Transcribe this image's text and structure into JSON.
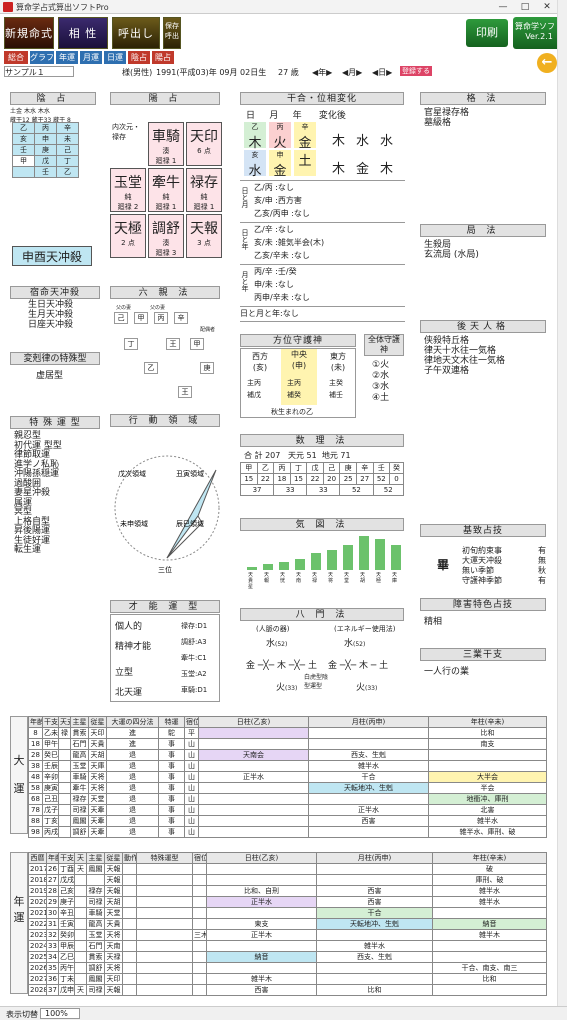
{
  "window": {
    "title": "算命学占式算出ソフトPro",
    "min": "—",
    "max": "□",
    "close": "✕"
  },
  "topbuttons": [
    {
      "top": "新規命式",
      "sub": ""
    },
    {
      "top": "相 性",
      "sub": ""
    },
    {
      "top": "呼出し",
      "sub": ""
    },
    {
      "top": "保存",
      "sub": "呼出"
    }
  ],
  "print_label": "印刷",
  "version": {
    "l1": "算命学ソフト",
    "l2": "Ver.2.1"
  },
  "nav": [
    "総合",
    "グラフ",
    "年運",
    "月運",
    "日運",
    "陰占",
    "陽占"
  ],
  "info": {
    "name": "サンプル１",
    "gender": "様(男性)",
    "date": "1991(平成03)年 09月 02日生",
    "age": "27 歳",
    "y": "◀年▶",
    "m": "◀月▶",
    "d": "◀日▶",
    "reg": "登録する"
  },
  "inzen": {
    "title": "陰 占",
    "hdr": [
      [
        "土金",
        "蔵干12"
      ],
      [
        "木水",
        "蔵干33"
      ],
      [
        "木水",
        "蔵干 8"
      ]
    ],
    "rows": [
      [
        "乙",
        "丙",
        "辛"
      ],
      [
        "亥",
        "申",
        "未"
      ],
      [
        "壬",
        "庚",
        "己"
      ],
      [
        "甲",
        "戊",
        "丁"
      ],
      [
        "",
        "壬",
        "乙"
      ]
    ],
    "tenchu": "申酉天冲殺"
  },
  "yozen": {
    "title": "陽 占",
    "side": "内次元・禄存",
    "cells": [
      {
        "k": "",
        "s1": "",
        "s2": ""
      },
      {
        "k": "車騎",
        "s1": "湊",
        "s2": "廻禄 1"
      },
      {
        "k": "天印",
        "s1": "",
        "s2": "6 点"
      },
      {
        "k": "玉堂",
        "s1": "純",
        "s2": "廻禄 2"
      },
      {
        "k": "牽牛",
        "s1": "純",
        "s2": "廻禄 1"
      },
      {
        "k": "禄存",
        "s1": "純",
        "s2": "廻禄 1"
      },
      {
        "k": "天極",
        "s1": "",
        "s2": "2 点"
      },
      {
        "k": "調舒",
        "s1": "湊",
        "s2": "廻禄 3"
      },
      {
        "k": "天報",
        "s1": "",
        "s2": "3 点"
      }
    ]
  },
  "kango": {
    "title": "干合・位相変化",
    "hdr": [
      "日",
      "月",
      "年",
      "変化後"
    ],
    "top": [
      "乙",
      "丙",
      "辛"
    ],
    "topk": [
      "木",
      "火",
      "金"
    ],
    "mid": [
      "亥",
      "申"
    ],
    "midk": [
      "水",
      "金"
    ],
    "after1": [
      "木",
      "水",
      "水"
    ],
    "after2": [
      "木",
      "金",
      "木"
    ],
    "relations": [
      {
        "g": "日と月",
        "l": [
          "乙/丙 :なし",
          "亥/申 :西方害",
          "乙亥/丙申 :なし"
        ]
      },
      {
        "g": "日と年",
        "l": [
          "乙/辛 :なし",
          "亥/未 :雑気半会(木)",
          "乙亥/辛未 :なし"
        ]
      },
      {
        "g": "月と年",
        "l": [
          "丙/辛 :壬/癸",
          "申/未 :なし",
          "丙申/辛未 :なし"
        ]
      }
    ],
    "footer": "日と月と年:なし"
  },
  "kakuho": {
    "title": "格 法",
    "items": [
      "官星禄存格",
      "墓級格"
    ]
  },
  "kyokuho": {
    "title": "局 法",
    "items": [
      "生殺局",
      "玄流局 (水局)"
    ]
  },
  "gotenjin": {
    "title": "後天人格",
    "items": [
      "侠殺特丘格",
      "律天十水往一気格",
      "律地天文木往一気格",
      "子午双連格"
    ]
  },
  "kisou": {
    "title": "基致占技",
    "main": "畢",
    "items": [
      [
        "初旬約束事",
        "有"
      ],
      [
        "大運天冲殺",
        "無"
      ],
      [
        "無い季節",
        "秋"
      ],
      [
        "守護神季節",
        "有"
      ]
    ]
  },
  "shogai": {
    "title": "障害特色占技",
    "items": [
      "精相"
    ]
  },
  "sanpo": {
    "title": "三業干支",
    "items": [
      "一人行の業"
    ]
  },
  "shukumei": {
    "title": "宿命天冲殺",
    "items": [
      "生日天冲殺",
      "生月天冲殺",
      "日座天冲殺"
    ]
  },
  "hensoku": {
    "title": "変剋律の特殊型",
    "items": [
      "虚居型"
    ]
  },
  "tokushu": {
    "title": "特 殊 運 型",
    "items": [
      "親忍型",
      "初代運 型型",
      "律節取運",
      "進学ノ私恥",
      "沖陽孫穏運",
      "過酸囲",
      "妻星沖殺",
      "属運",
      "冥型",
      "上格自型",
      "昇後陽運",
      "生徒好運",
      "転生運"
    ]
  },
  "rikushin": {
    "title": "六 親 法",
    "labels": [
      "父の妻",
      "父の妻",
      "配偶者",
      "己",
      "甲",
      "丙",
      "辛",
      "丁",
      "王",
      "甲",
      "乙",
      "己",
      "庚",
      "王",
      "配偶者",
      "配偶者",
      "兄弟",
      "弟",
      "子供",
      "男の子供の子"
    ]
  },
  "koudou": {
    "title": "行 動 領 域",
    "labels": [
      "戊次領域",
      "丑寅領域",
      "未申領域",
      "辰巳領域",
      "三位",
      "昇型"
    ]
  },
  "houi": {
    "title": "方位守護神",
    "cols": [
      {
        "h": "西方",
        "s": "(亥)",
        "a": "主丙",
        "b": "補戊"
      },
      {
        "h": "中央",
        "s": "(申)",
        "a": "主丙",
        "b": "補癸"
      },
      {
        "h": "東方",
        "s": "(未)",
        "a": "主癸",
        "b": "補壬"
      }
    ],
    "foot": "秋生まれの乙"
  },
  "zentai": {
    "title": "全体守護神",
    "items": [
      "①火",
      "②水",
      "③水",
      "④土"
    ]
  },
  "suri": {
    "title": "数 理 法",
    "total": "合 計 207",
    "ten": "天元 51",
    "chi": "地元 71",
    "k": [
      "甲",
      "乙",
      "丙",
      "丁",
      "戊",
      "己",
      "庚",
      "辛",
      "壬",
      "癸"
    ],
    "v": [
      "15",
      "22",
      "18",
      "15",
      "22",
      "20",
      "25",
      "27",
      "52",
      "0"
    ],
    "sum": [
      "37",
      "33",
      "33",
      "52",
      "52"
    ]
  },
  "kizu": {
    "title": "気 図 法",
    "vals": [
      1,
      2,
      3,
      4,
      6,
      7,
      9,
      12,
      11,
      9
    ],
    "labels": [
      "天貴星",
      "天報",
      "天恍",
      "天南",
      "天禄",
      "天将",
      "天堂",
      "天胡",
      "天極",
      "天庫"
    ]
  },
  "hachimon": {
    "title": "八 門 法",
    "left": "(人脈の器)",
    "right": "(エネルギー使用法)",
    "foot": "白虎型陰型運型"
  },
  "saino": {
    "title": "才 能 運 型",
    "items": [
      [
        "個人的",
        "禄存:D1"
      ],
      [
        "精神才能",
        "調舒:A3"
      ],
      [
        "",
        "牽牛:C1"
      ],
      [
        "立型",
        "玉堂:A2"
      ],
      [
        "北天運",
        "車騎:D1"
      ]
    ]
  },
  "taiun": {
    "side": "大運",
    "header": [
      "年齢",
      "干支",
      "天支",
      "主星",
      "従星",
      "大運の四分法",
      "特運",
      "宿位",
      "日柱(乙亥)",
      "月柱(丙申)",
      "年柱(辛未)"
    ],
    "rows": [
      [
        "8",
        "乙未",
        "禄",
        "貫索",
        "天印",
        "進",
        "駝",
        "平",
        "",
        "",
        "比和"
      ],
      [
        "18",
        "甲午",
        "",
        "石門",
        "天貴",
        "進",
        "事",
        "山",
        "",
        "",
        "南支"
      ],
      [
        "28",
        "癸巳",
        "",
        "龍高",
        "天胡",
        "退",
        "事",
        "山",
        "天南会",
        "西支、生剋",
        ""
      ],
      [
        "38",
        "壬辰",
        "",
        "玉堂",
        "天庫",
        "退",
        "事",
        "山",
        "",
        "雑半水",
        ""
      ],
      [
        "48",
        "辛卯",
        "",
        "車騎",
        "天将",
        "退",
        "事",
        "山",
        "正半水",
        "干合",
        "大半会"
      ],
      [
        "58",
        "庚寅",
        "",
        "牽牛",
        "天将",
        "退",
        "事",
        "山",
        "",
        "天転地冲、生剋",
        "半会"
      ],
      [
        "68",
        "己丑",
        "",
        "禄存",
        "天堂",
        "退",
        "事",
        "山",
        "",
        "",
        "地衝冲、庫刑"
      ],
      [
        "78",
        "戊子",
        "",
        "司禄",
        "天牽",
        "退",
        "事",
        "山",
        "",
        "正半水",
        "北害"
      ],
      [
        "88",
        "丁亥",
        "",
        "鳳閣",
        "天牽",
        "退",
        "事",
        "山",
        "",
        "西害",
        "雑半水"
      ],
      [
        "98",
        "丙戌",
        "",
        "調舒",
        "天牽",
        "退",
        "事",
        "山",
        "",
        "",
        "雑半水、庫刑、破"
      ]
    ]
  },
  "nenun": {
    "side": "年運",
    "header": [
      "西暦",
      "年齢",
      "干支",
      "天",
      "主星",
      "従星",
      "動作",
      "特殊運型",
      "宿位",
      "日柱(乙亥)",
      "月柱(丙申)",
      "年柱(辛未)"
    ],
    "rows": [
      [
        "2017",
        "26",
        "丁酉",
        "天",
        "鳳閣",
        "天報",
        "",
        "",
        "",
        "",
        "",
        "破"
      ],
      [
        "2018",
        "27",
        "戊戌",
        "",
        "",
        "天報",
        "",
        "",
        "",
        "",
        "",
        "庫刑、破"
      ],
      [
        "2019",
        "28",
        "己亥",
        "",
        "禄存",
        "天報",
        "",
        "",
        "",
        "比和、自刑",
        "西害",
        "雑半水"
      ],
      [
        "2020",
        "29",
        "庚子",
        "",
        "司禄",
        "天胡",
        "",
        "",
        "",
        "正半水",
        "西害",
        "雑半水"
      ],
      [
        "2021",
        "30",
        "辛丑",
        "",
        "車騎",
        "天堂",
        "",
        "",
        "",
        "",
        "干合",
        ""
      ],
      [
        "2022",
        "31",
        "壬寅",
        "",
        "龍高",
        "天貴",
        "",
        "",
        "",
        "東支",
        "天転地冲、生剋",
        "納音"
      ],
      [
        "2023",
        "32",
        "癸卯",
        "",
        "玉堂",
        "天将",
        "",
        "",
        "三木",
        "正半木",
        "",
        "雑半木"
      ],
      [
        "2024",
        "33",
        "甲辰",
        "",
        "石門",
        "天南",
        "",
        "",
        "",
        "",
        "雑半水",
        ""
      ],
      [
        "2025",
        "34",
        "乙巳",
        "",
        "貫索",
        "天禄",
        "",
        "",
        "",
        "納音",
        "西支、生剋",
        ""
      ],
      [
        "2026",
        "35",
        "丙午",
        "",
        "調舒",
        "天将",
        "",
        "",
        "",
        "",
        "",
        "干合、南支、南三"
      ],
      [
        "2027",
        "36",
        "丁未",
        "",
        "鳳閣",
        "天印",
        "",
        "",
        "",
        "雑半木",
        "",
        "比和"
      ],
      [
        "2028",
        "37",
        "戊申",
        "天",
        "司禄",
        "天報",
        "",
        "",
        "",
        "西害",
        "比和",
        ""
      ]
    ]
  },
  "status": {
    "label": "表示切替",
    "zoom": "100%"
  }
}
